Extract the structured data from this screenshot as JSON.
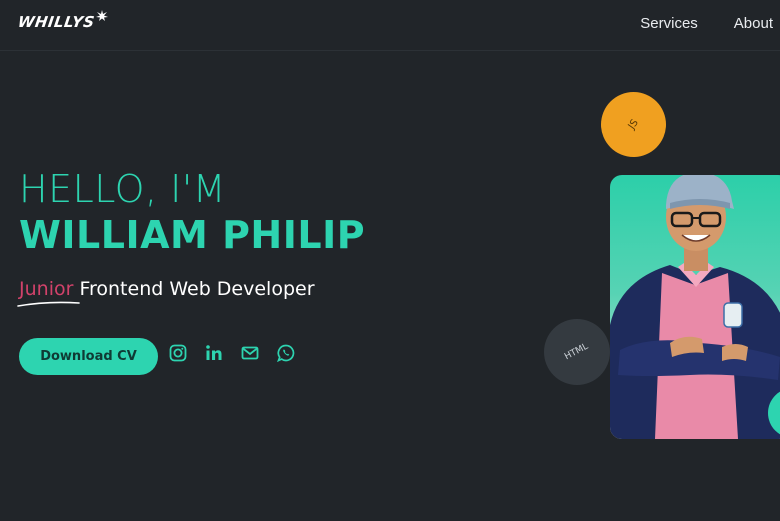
{
  "header": {
    "logo_text": "WHILLYS",
    "nav": [
      {
        "label": "Services"
      },
      {
        "label": "About"
      }
    ]
  },
  "hero": {
    "greeting": "HELLO, I'M",
    "name": "WILLIAM PHILIP",
    "role_highlight": "Junior",
    "role_rest": " Frontend Web Developer",
    "cv_button": "Download CV"
  },
  "socials": [
    {
      "icon": "instagram-icon"
    },
    {
      "icon": "linkedin-icon"
    },
    {
      "icon": "email-icon"
    },
    {
      "icon": "whatsapp-icon"
    }
  ],
  "bubbles": {
    "js": "JS",
    "html": "HTML"
  },
  "colors": {
    "background": "#212529",
    "accent": "#2dd4b0",
    "highlight": "#d1426a",
    "js_bubble": "#f0a020",
    "html_bubble": "#343a40"
  }
}
